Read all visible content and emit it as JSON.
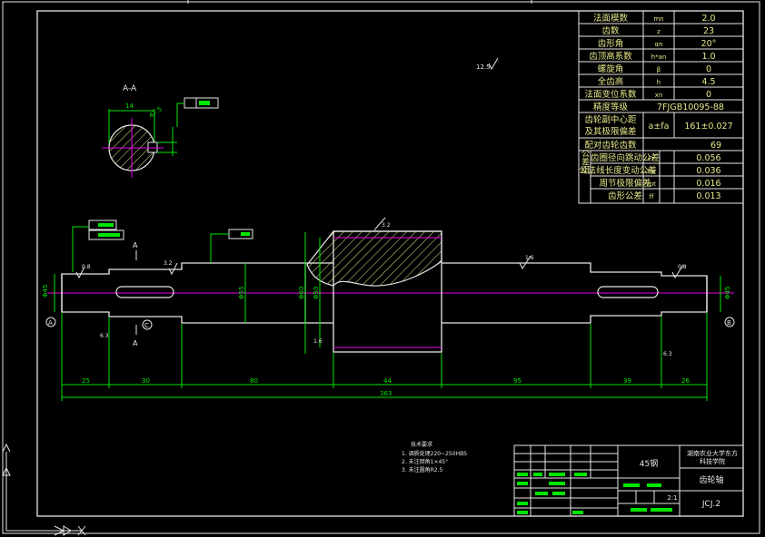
{
  "table": {
    "rows": [
      {
        "name": "法面模数",
        "sym": "mn",
        "val": "2.0"
      },
      {
        "name": "齿数",
        "sym": "z",
        "val": "23"
      },
      {
        "name": "齿形角",
        "sym": "αn",
        "val": "20°"
      },
      {
        "name": "齿顶高系数",
        "sym": "h*an",
        "val": "1.0"
      },
      {
        "name": "螺旋角",
        "sym": "β",
        "val": "0"
      },
      {
        "name": "全齿高",
        "sym": "h",
        "val": "4.5"
      },
      {
        "name": "法面变位系数",
        "sym": "xn",
        "val": "0"
      }
    ],
    "precision_label": "精度等级",
    "precision_value": "7FJGB10095-88",
    "center_label_1": "齿轮副中心距",
    "center_label_2": "及其极限偏差",
    "center_sym": "a±fa",
    "center_val": "161±0.027",
    "mate_label": "配对齿轮齿数",
    "mate_val": "69",
    "group_label": "公差组",
    "tol_rows": [
      {
        "name": "齿圈径向跳动公差",
        "sym": "Fr",
        "val": "0.056"
      },
      {
        "name": "公法线长度变动公差",
        "sym": "Fw",
        "val": "0.036"
      },
      {
        "name": "周节极限偏差",
        "sym": "fpt",
        "val": "0.016"
      },
      {
        "name": "齿形公差",
        "sym": "ff",
        "val": "0.013"
      }
    ]
  },
  "section": {
    "title": "A-A",
    "dim_width": "14",
    "dim_height": "47.5"
  },
  "shaft": {
    "view_mark": "A",
    "datum_left": "A",
    "datum_right": "B",
    "datum_c": "C",
    "dims": [
      "25",
      "30",
      "80",
      "44",
      "95",
      "39",
      "26"
    ],
    "overall": "363",
    "diameters": [
      "Φ45",
      "Φ55",
      "Φ50",
      "Φ60",
      "Φ45"
    ],
    "roughness": [
      "0.8",
      "1.6",
      "3.2",
      "6.3",
      "12.5"
    ]
  },
  "notes": {
    "title": "技术要求",
    "lines": [
      "1. 调质处理220~250HBS",
      "2. 未注倒角1×45°",
      "3. 未注圆角R2.5"
    ]
  },
  "title_block": {
    "material": "45钢",
    "school_line1": "湖南农业大学东方",
    "school_line2": "科技学院",
    "part_name": "齿轮轴",
    "scale": "2:1",
    "drawing_no": "JCJ.2"
  },
  "colors": {
    "background": "#000000",
    "frame": "#e6e6e6",
    "dimension": "#00e600",
    "centerline": "#e600e6",
    "hatch": "#e6e68c"
  }
}
